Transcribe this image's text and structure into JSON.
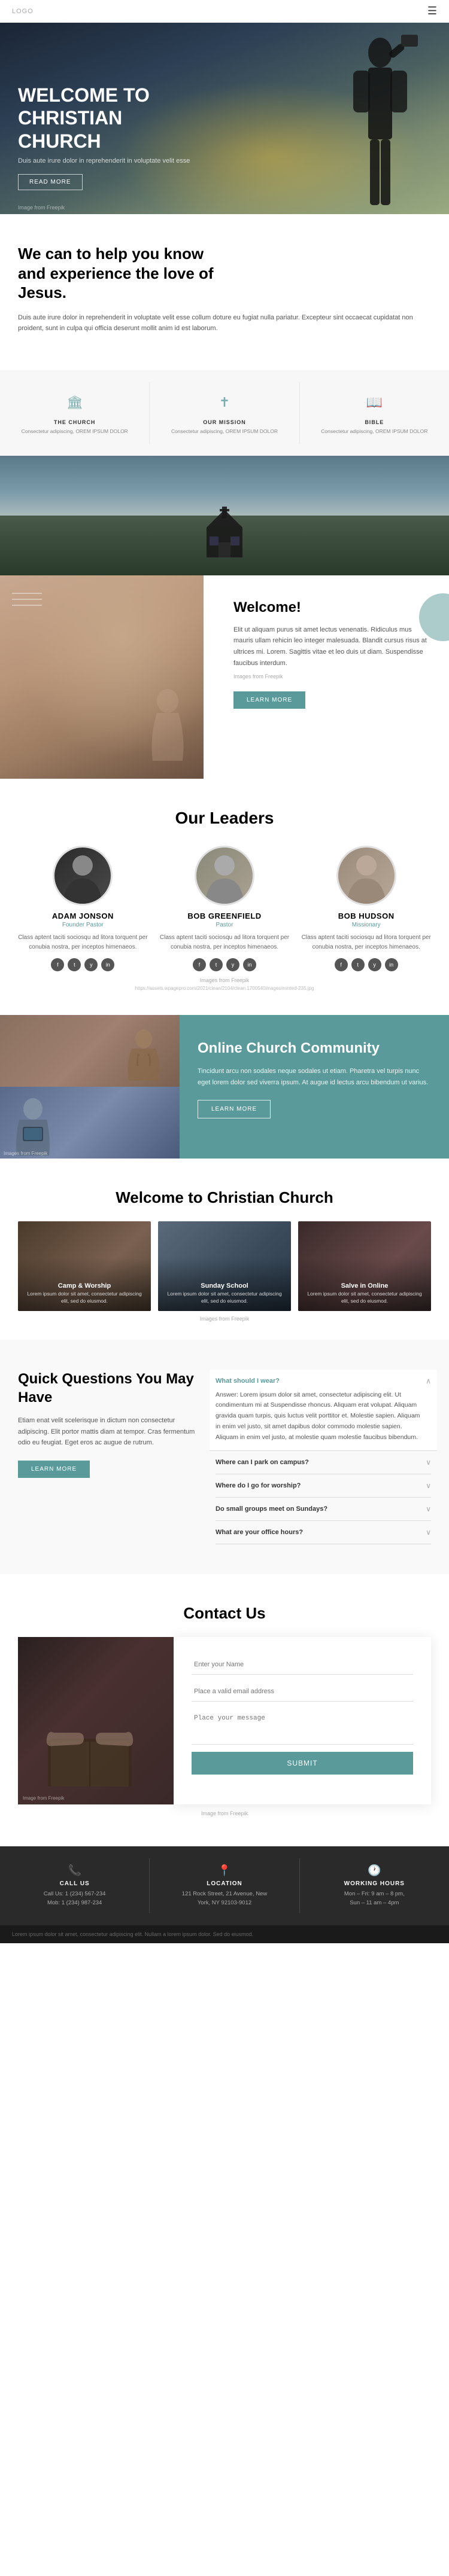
{
  "meta": {
    "logo": "logo"
  },
  "hero": {
    "title": "WELCOME TO CHRISTIAN CHURCH",
    "description": "Duis aute irure dolor in reprehenderit in voluptate velit esse",
    "cta_label": "READ MORE",
    "image_credit": "Image from Freepik"
  },
  "know_section": {
    "heading": "We can to help you know and experience the love of Jesus.",
    "description": "Duis aute irure dolor in reprehenderit in voluptate velit esse collum doture eu fugiat nulla pariatur. Excepteur sint occaecat cupidatat non proident, sunt in culpa qui officia deserunt mollit anim id est laborum.",
    "icons": [
      {
        "icon": "🏛",
        "title": "THE CHURCH",
        "description": "Consectetur adipiscing, OREM IPSUM DOLOR"
      },
      {
        "icon": "✝",
        "title": "OUR MISSION",
        "description": "Consectetur adipiscing, OREM IPSUM DOLOR"
      },
      {
        "icon": "📖",
        "title": "BIBLE",
        "description": "Consectetur adipiscing, OREM IPSUM DOLOR"
      }
    ]
  },
  "welcome_section": {
    "heading": "Welcome!",
    "body1": "Elit ut aliquam purus sit amet lectus venenatis. Ridiculus mus mauris ullam rehicin leo integer malesuada. Blandit cursus risus at ultrices mi. Lorem. Sagittis vitae et leo duis ut diam. Suspendisse faucibus interdum.",
    "image_credit": "Images from Freepik",
    "cta_label": "LEARN MORE"
  },
  "leaders_section": {
    "heading": "Our Leaders",
    "leaders": [
      {
        "name": "ADAM JONSON",
        "role": "Founder Pastor",
        "description": "Class aptent taciti sociosqu ad litora torquent per conubia nostra, per inceptos himenaeos."
      },
      {
        "name": "BOB GREENFIELD",
        "role": "Pastor",
        "description": "Class aptent taciti sociosqu ad litora torquent per conubia nostra, per inceptos himenaeos."
      },
      {
        "name": "BOB HUDSON",
        "role": "Missionary",
        "description": "Class aptent taciti sociosqu ad litora torquent per conubia nostra, per inceptos himenaeos."
      }
    ],
    "image_credit": "Images from Freepik",
    "url_text": "https://assets.wpagepro.com/2021/clean/2104/clean.1700540images/minted-235.jpg"
  },
  "online_section": {
    "heading": "Online Church Community",
    "body": "Tincidunt arcu non sodales neque sodales ut etiam. Pharetra vel turpis nunc eget lorem dolor sed viverra ipsum. At augue id lectus arcu bibendum ut varius.",
    "cta_label": "LEARN MORE",
    "image_credit": "Images from Freepik"
  },
  "gallery_section": {
    "heading": "Welcome to Christian Church",
    "items": [
      {
        "title": "Camp & Worship",
        "description": "Lorem ipsum dolor sit amet, consectetur adipiscing elit, sed do eiusmod."
      },
      {
        "title": "Sunday School",
        "description": "Lorem ipsum dolor sit amet, consectetur adipiscing elit, sed do eiusmod."
      },
      {
        "title": "Salve in Online",
        "description": "Lorem ipsum dolor sit amet, consectetur adipiscing elit, sed do eiusmod."
      }
    ],
    "image_credit": "Images from Freepik"
  },
  "faq_section": {
    "heading": "Quick Questions You May Have",
    "description": "Etiam enat velit scelerisque in dictum non consectetur adipiscing. Elit portor mattis diam at tempor. Cras fermentum odio eu feugiat. Eget eros ac augue de rutrum.",
    "cta_label": "LEARN MORE",
    "questions": [
      {
        "question": "What should I wear?",
        "answer": "Answer: Lorem ipsum dolor sit amet, consectetur adipiscing elit. Ut condimentum mi at Suspendisse rhoncus. Aliquam erat volupat. Aliquam gravida quam turpis, quis luctus velit porttitor et. Molestie sapien. Aliquam in enim vel justo, sit amet dapibus dolor commodo molestie sapien. Aliquam in enim vel justo, at molestie quam molestie faucibus bibendum.",
        "active": true
      },
      {
        "question": "Where can I park on campus?",
        "answer": "",
        "active": false
      },
      {
        "question": "Where do I go for worship?",
        "answer": "",
        "active": false
      },
      {
        "question": "Do small groups meet on Sundays?",
        "answer": "",
        "active": false
      },
      {
        "question": "What are your office hours?",
        "answer": "",
        "active": false
      }
    ]
  },
  "contact_section": {
    "heading": "Contact Us",
    "name_placeholder": "Enter your Name",
    "email_placeholder": "Place a valid email address",
    "message_placeholder": "Place your message",
    "submit_label": "Submit",
    "image_credit": "Image from Freepik"
  },
  "footer": {
    "cols": [
      {
        "icon": "📞",
        "title": "CALL US",
        "lines": [
          "Call Us: 1 (234) 567-234",
          "Mob: 1 (234) 987-234"
        ]
      },
      {
        "icon": "📍",
        "title": "LOCATION",
        "lines": [
          "121 Rock Street, 21 Avenue, New",
          "York, NY 92103-9012"
        ]
      },
      {
        "icon": "🕐",
        "title": "WORKING HOURS",
        "lines": [
          "Mon – Fri: 9 am – 8 pm,",
          "Sun – 11 am – 4pm"
        ]
      }
    ]
  },
  "bottom_bar": {
    "left": "Lorem ipsum dolor sit amet, consectetur adipiscing elit. Nullam a lorem ipsum dolor. Sed do eiusmod.",
    "right": ""
  }
}
